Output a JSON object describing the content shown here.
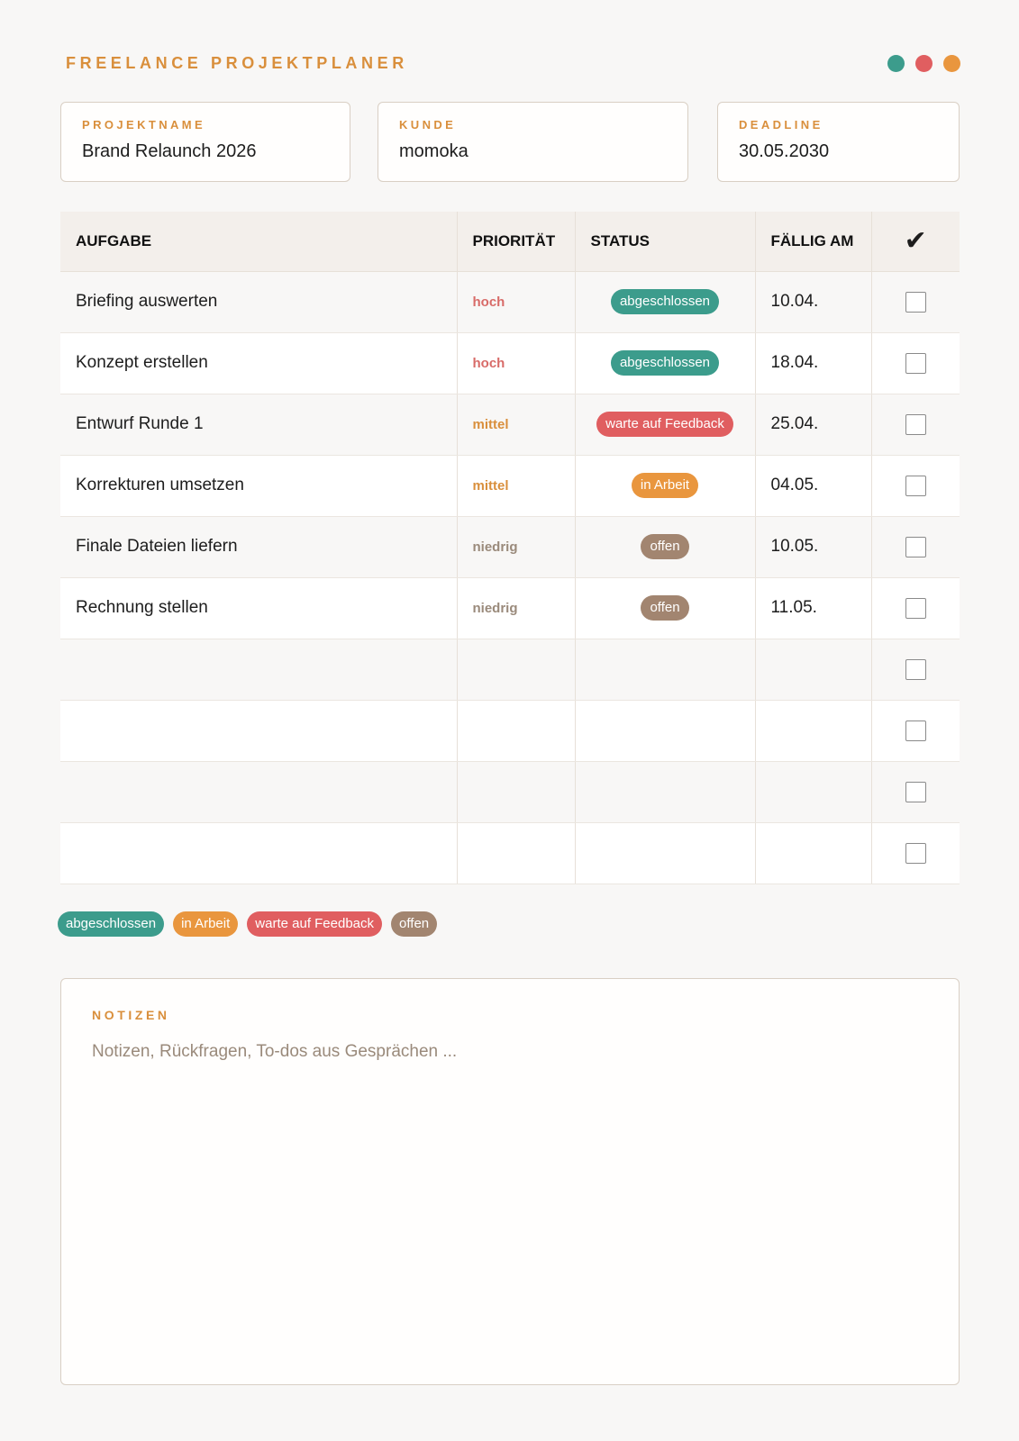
{
  "title": "FREELANCE PROJEKTPLANER",
  "colors": {
    "accent": "#d98f3c",
    "abgeschlossen": "#3c9c8c",
    "in_arbeit": "#e9963e",
    "warte": "#e05e60",
    "offen": "#a28570",
    "prio_hoch": "#d86b68",
    "prio_mittel": "#d98f3c",
    "prio_niedrig": "#9a8a7b"
  },
  "dots": [
    "#3c9c8c",
    "#e05e60",
    "#e9963e"
  ],
  "fields": {
    "projektname": {
      "label": "PROJEKTNAME",
      "value": "Brand Relaunch 2026"
    },
    "kunde": {
      "label": "KUNDE",
      "value": "momoka"
    },
    "deadline": {
      "label": "DEADLINE",
      "value": "30.05.2030"
    }
  },
  "table": {
    "headers": {
      "aufgabe": "AUFGABE",
      "prioritaet": "PRIORITÄT",
      "status": "STATUS",
      "faellig": "FÄLLIG AM",
      "done": "✔"
    },
    "rows": [
      {
        "aufgabe": "Briefing auswerten",
        "prioritaet": "hoch",
        "status": "abgeschlossen",
        "faellig": "10.04."
      },
      {
        "aufgabe": "Konzept erstellen",
        "prioritaet": "hoch",
        "status": "abgeschlossen",
        "faellig": "18.04."
      },
      {
        "aufgabe": "Entwurf Runde 1",
        "prioritaet": "mittel",
        "status": "warte auf Feedback",
        "faellig": "25.04."
      },
      {
        "aufgabe": "Korrekturen umsetzen",
        "prioritaet": "mittel",
        "status": "in Arbeit",
        "faellig": "04.05."
      },
      {
        "aufgabe": "Finale Dateien liefern",
        "prioritaet": "niedrig",
        "status": "offen",
        "faellig": "10.05."
      },
      {
        "aufgabe": "Rechnung stellen",
        "prioritaet": "niedrig",
        "status": "offen",
        "faellig": "11.05."
      },
      {
        "aufgabe": "",
        "prioritaet": "",
        "status": "",
        "faellig": ""
      },
      {
        "aufgabe": "",
        "prioritaet": "",
        "status": "",
        "faellig": ""
      },
      {
        "aufgabe": "",
        "prioritaet": "",
        "status": "",
        "faellig": ""
      },
      {
        "aufgabe": "",
        "prioritaet": "",
        "status": "",
        "faellig": ""
      }
    ]
  },
  "legend": [
    "abgeschlossen",
    "in Arbeit",
    "warte auf Feedback",
    "offen"
  ],
  "notes": {
    "label": "NOTIZEN",
    "placeholder": "Notizen, Rückfragen, To-dos aus Gesprächen ..."
  }
}
